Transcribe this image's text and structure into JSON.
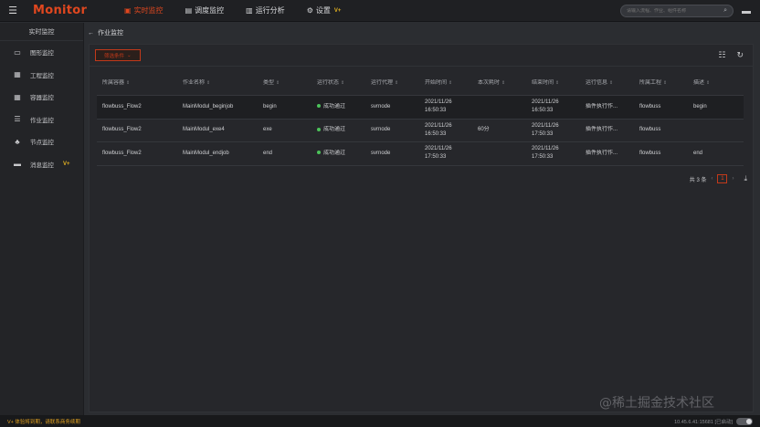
{
  "topbar": {
    "brand": "Monitor",
    "nav": [
      {
        "icon": "monitor-icon",
        "glyph": "▣",
        "label": "实时监控",
        "active": true
      },
      {
        "icon": "schedule-icon",
        "glyph": "▤",
        "label": "调度监控",
        "active": false
      },
      {
        "icon": "analysis-icon",
        "glyph": "▥",
        "label": "运行分析",
        "active": false
      },
      {
        "icon": "gear-icon",
        "glyph": "⚙",
        "label": "设置",
        "active": false,
        "badge": "V+"
      }
    ],
    "search_placeholder": "请输入流程、作业、组件名称"
  },
  "sidebar": {
    "title": "实时监控",
    "items": [
      {
        "label": "图形监控",
        "glyph": "▭"
      },
      {
        "label": "工程监控",
        "glyph": "▦"
      },
      {
        "label": "容器监控",
        "glyph": "▦"
      },
      {
        "label": "作业监控",
        "glyph": "☰"
      },
      {
        "label": "节点监控",
        "glyph": "♣"
      },
      {
        "label": "消息监控",
        "glyph": "▬",
        "badge": "V+"
      }
    ]
  },
  "breadcrumb": {
    "label": "作业监控"
  },
  "toolbar": {
    "filter_label": "筛选条件"
  },
  "table": {
    "columns": [
      "所属容器",
      "作业名称",
      "类型",
      "运行状态",
      "运行代理",
      "开始时间",
      "本次耗时",
      "结束时间",
      "运行信息",
      "所属工程",
      "描述"
    ],
    "rows": [
      [
        "flowbuss_Flow2",
        "MainModul_beginjob",
        "begin",
        "成功通过",
        "svrnode",
        "2021/11/26 16:50:33",
        "",
        "2021/11/26 16:50:33",
        "插件执行作...",
        "flowbuss",
        "begin"
      ],
      [
        "flowbuss_Flow2",
        "MainModul_exe4",
        "exe",
        "成功通过",
        "svrnode",
        "2021/11/26 16:50:33",
        "60分",
        "2021/11/26 17:50:33",
        "插件执行作...",
        "flowbuss",
        ""
      ],
      [
        "flowbuss_Flow2",
        "MainModul_endjob",
        "end",
        "成功通过",
        "svrnode",
        "2021/11/26 17:50:33",
        "",
        "2021/11/26 17:50:33",
        "插件执行作...",
        "flowbuss",
        "end"
      ]
    ]
  },
  "pager": {
    "total_label": "共 3 条",
    "current_page": "1"
  },
  "footer": {
    "warning": "V+ 体验将到期，请联系商务续期",
    "info": "10.45.6.41:15681 [已启动]"
  },
  "watermark": "@稀土掘金技术社区",
  "colors": {
    "accent": "#e0471f",
    "status_success": "#4cc35a",
    "vip": "#e6b422"
  }
}
